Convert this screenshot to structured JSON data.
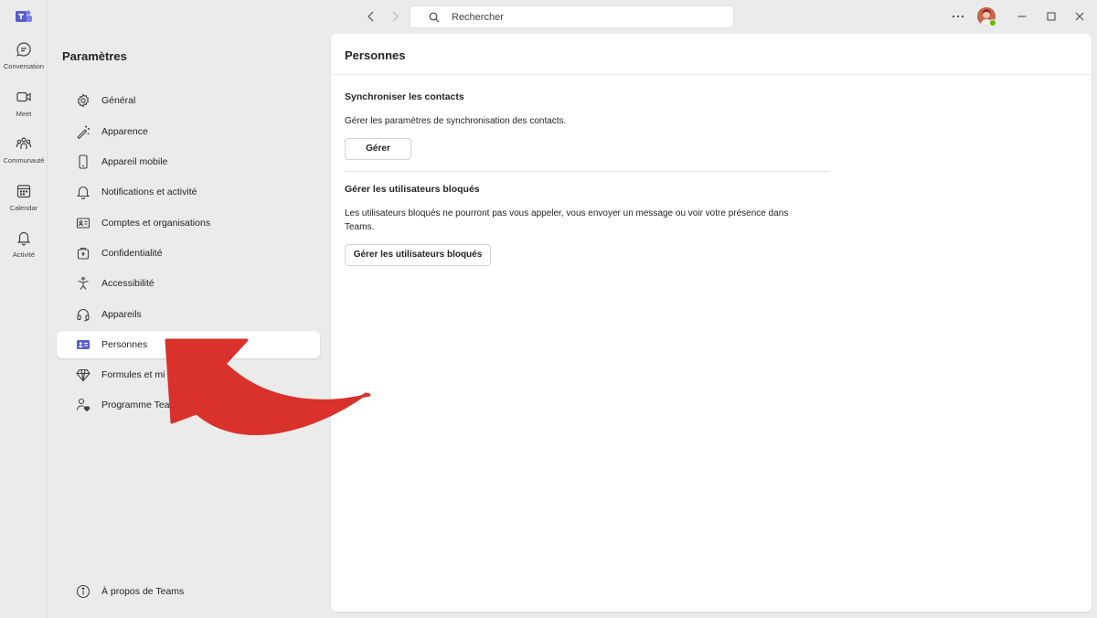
{
  "rail": {
    "items": [
      {
        "label": "Conversation",
        "icon": "chat-icon"
      },
      {
        "label": "Meet",
        "icon": "video-icon"
      },
      {
        "label": "Communauté",
        "icon": "community-icon"
      },
      {
        "label": "Calendar",
        "icon": "calendar-icon"
      },
      {
        "label": "Activité",
        "icon": "bell-icon"
      }
    ]
  },
  "search": {
    "placeholder": "Rechercher"
  },
  "settings": {
    "title": "Paramètres",
    "items": [
      {
        "label": "Général",
        "icon": "gear-icon"
      },
      {
        "label": "Apparence",
        "icon": "magic-wand-icon"
      },
      {
        "label": "Appareil mobile",
        "icon": "phone-icon"
      },
      {
        "label": "Notifications et activité",
        "icon": "bell-icon"
      },
      {
        "label": "Comptes et organisations",
        "icon": "id-card-icon"
      },
      {
        "label": "Confidentialité",
        "icon": "lock-icon"
      },
      {
        "label": "Accessibilité",
        "icon": "accessibility-icon"
      },
      {
        "label": "Appareils",
        "icon": "headset-icon"
      },
      {
        "label": "Personnes",
        "icon": "contact-card-icon",
        "active": true
      },
      {
        "label": "Formules et mi",
        "icon": "diamond-icon"
      },
      {
        "label": "Programme Tea",
        "icon": "person-heart-icon"
      }
    ],
    "about": {
      "label": "À propos de Teams",
      "icon": "info-icon"
    }
  },
  "content": {
    "title": "Personnes",
    "sync": {
      "title": "Synchroniser les contacts",
      "desc": "Gérer les paramètres de synchronisation des contacts.",
      "button": "Gérer"
    },
    "blocked": {
      "title": "Gérer les utilisateurs bloqués",
      "desc": "Les utilisateurs bloqués ne pourront pas vous appeler, vous envoyer un message ou voir votre présence dans Teams.",
      "button": "Gérer les utilisateurs bloqués"
    }
  },
  "colors": {
    "accent": "#5b5fc7",
    "arrow": "#d9312b",
    "presence": "#6bb700"
  }
}
